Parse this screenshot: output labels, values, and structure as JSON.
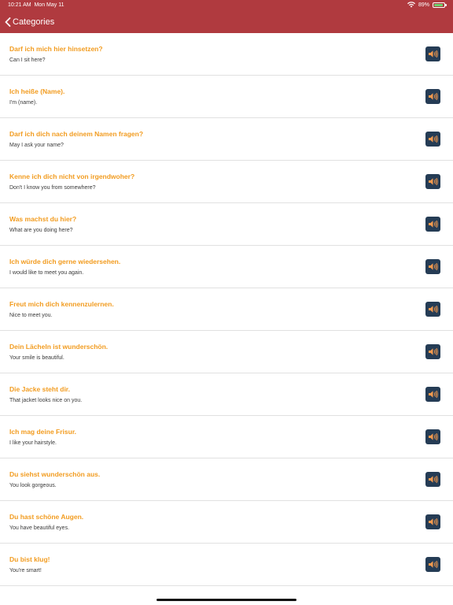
{
  "status_bar": {
    "time": "10:21 AM",
    "date": "Mon May 11",
    "battery": "89%"
  },
  "nav": {
    "back_label": "Categories"
  },
  "colors": {
    "header": "#b03a3f",
    "phrase": "#f29c20",
    "speaker_bg": "#253c55",
    "speaker_icon": "#f39a4e"
  },
  "phrases": [
    {
      "de": "Darf ich mich hier hinsetzen?",
      "en": "Can I sit here?"
    },
    {
      "de": "Ich heiße (Name).",
      "en": "I'm (name)."
    },
    {
      "de": "Darf ich dich nach deinem Namen fragen?",
      "en": "May I ask your name?"
    },
    {
      "de": "Kenne ich dich nicht von irgendwoher?",
      "en": "Don't I know you from somewhere?"
    },
    {
      "de": "Was machst du hier?",
      "en": "What are you doing here?"
    },
    {
      "de": "Ich würde dich gerne wiedersehen.",
      "en": "I would like to meet you again."
    },
    {
      "de": "Freut mich dich kennenzulernen.",
      "en": "Nice to meet you."
    },
    {
      "de": "Dein Lächeln ist wunderschön.",
      "en": "Your smile is beautiful."
    },
    {
      "de": "Die Jacke steht dir.",
      "en": "That jacket looks nice on you."
    },
    {
      "de": "Ich mag deine Frisur.",
      "en": "I like your hairstyle."
    },
    {
      "de": "Du siehst wunderschön aus.",
      "en": "You look gorgeous."
    },
    {
      "de": "Du hast schöne Augen.",
      "en": "You have beautiful eyes."
    },
    {
      "de": "Du bist klug!",
      "en": "You're smart!"
    }
  ]
}
